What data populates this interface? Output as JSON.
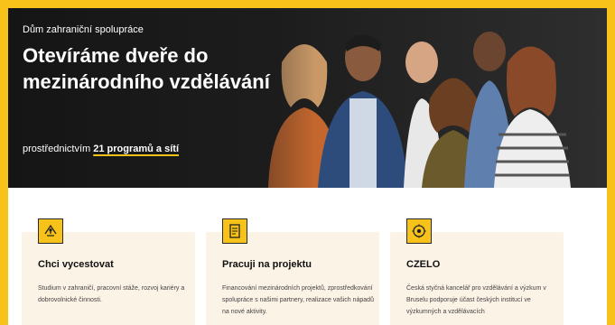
{
  "hero": {
    "eyebrow": "Dům zahraniční spolupráce",
    "title": "Otevíráme dveře do mezinárodního vzdělávání",
    "subtitle_prefix": "prostřednictvím ",
    "subtitle_highlight": "21 programů a sítí"
  },
  "cards": [
    {
      "icon": "travel-icon",
      "title": "Chci vycestovat",
      "text": "Studium v zahraničí, pracovní stáže, rozvoj kariéry a dobrovolnické činnosti."
    },
    {
      "icon": "document-icon",
      "title": "Pracuji na projektu",
      "text": "Financování mezinárodních projektů, zprostředkování spolupráce s našimi partnery, realizace vašich nápadů na nové aktivity."
    },
    {
      "icon": "eu-emblem-icon",
      "title": "CZELO",
      "text": "Česká styčná kancelář pro vzdělávání a výzkum v Bruselu podporuje účast českých institucí ve výzkumných a vzdělávacích"
    }
  ],
  "colors": {
    "accent": "#f7c21a",
    "card_bg": "#fcf3e7",
    "hero_bg": "#1d1d1d"
  }
}
